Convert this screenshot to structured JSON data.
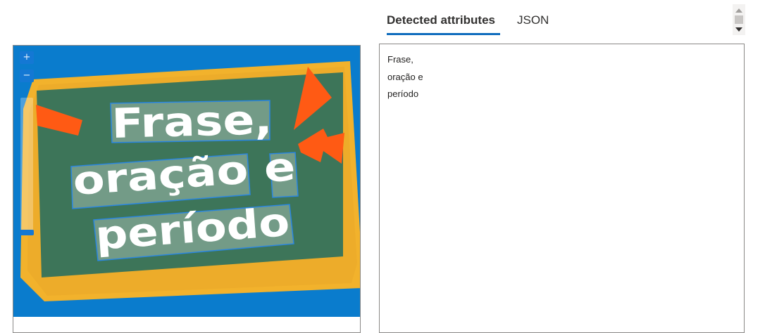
{
  "tabs": [
    {
      "label": "Detected attributes",
      "active": true
    },
    {
      "label": "JSON",
      "active": false
    }
  ],
  "image": {
    "headline_lines": [
      "Frase,",
      "oração e",
      "período"
    ],
    "zoom": {
      "in_label": "+",
      "out_label": "−"
    }
  },
  "detected_text": {
    "lines": [
      "Frase,",
      "oração e",
      "período"
    ]
  },
  "colors": {
    "accent": "#0f6cbd",
    "image_background": "#0078d4",
    "chalkboard": "#3d7559",
    "frame": "#f2b22c",
    "highlight": "#ff5a14"
  },
  "icons": {
    "scroll_up": "triangle-up-icon",
    "scroll_down": "triangle-down-icon"
  }
}
